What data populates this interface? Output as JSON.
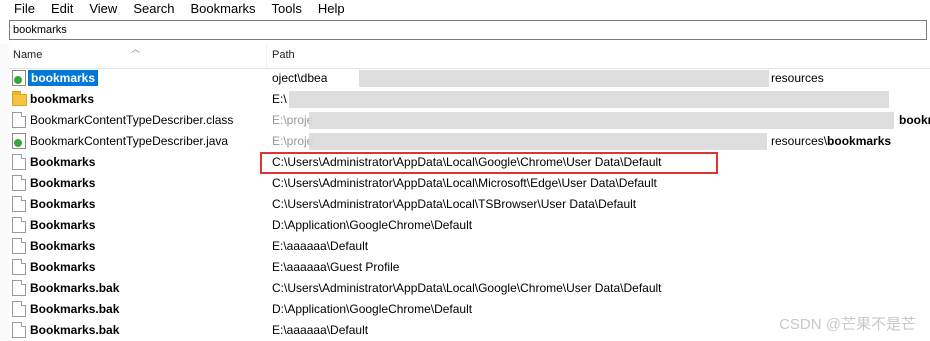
{
  "menu": [
    "File",
    "Edit",
    "View",
    "Search",
    "Bookmarks",
    "Tools",
    "Help"
  ],
  "search": {
    "value": "bookmarks"
  },
  "columns": {
    "name": "Name",
    "path": "Path"
  },
  "rows": [
    {
      "name": "bookmarks",
      "path": "",
      "icon": "app-file-icon",
      "bold": true,
      "selected": true
    },
    {
      "name": "bookmarks",
      "path": "E:\\",
      "icon": "folder-icon",
      "bold": true,
      "selected": false
    },
    {
      "name": "BookmarkContentTypeDescriber.class",
      "path": "",
      "icon": "file-icon",
      "bold": false,
      "selected": false
    },
    {
      "name": "BookmarkContentTypeDescriber.java",
      "path": "",
      "icon": "app-file-icon",
      "bold": false,
      "selected": false
    },
    {
      "name": "Bookmarks",
      "path": "C:\\Users\\Administrator\\AppData\\Local\\Google\\Chrome\\User Data\\Default",
      "icon": "file-icon",
      "bold": true,
      "selected": false
    },
    {
      "name": "Bookmarks",
      "path": "C:\\Users\\Administrator\\AppData\\Local\\Microsoft\\Edge\\User Data\\Default",
      "icon": "file-icon",
      "bold": true,
      "selected": false
    },
    {
      "name": "Bookmarks",
      "path": "C:\\Users\\Administrator\\AppData\\Local\\TSBrowser\\User Data\\Default",
      "icon": "file-icon",
      "bold": true,
      "selected": false
    },
    {
      "name": "Bookmarks",
      "path": "D:\\Application\\GoogleChrome\\Default",
      "icon": "file-icon",
      "bold": true,
      "selected": false
    },
    {
      "name": "Bookmarks",
      "path": "E:\\aaaaaa\\Default",
      "icon": "file-icon",
      "bold": true,
      "selected": false
    },
    {
      "name": "Bookmarks",
      "path": "E:\\aaaaaa\\Guest Profile",
      "icon": "file-icon",
      "bold": true,
      "selected": false
    },
    {
      "name": "Bookmarks.bak",
      "path": "C:\\Users\\Administrator\\AppData\\Local\\Google\\Chrome\\User Data\\Default",
      "icon": "file-icon",
      "bold": true,
      "selected": false
    },
    {
      "name": "Bookmarks.bak",
      "path": "D:\\Application\\GoogleChrome\\Default",
      "icon": "file-icon",
      "bold": true,
      "selected": false
    },
    {
      "name": "Bookmarks.bak",
      "path": "E:\\aaaaaa\\Default",
      "icon": "file-icon",
      "bold": true,
      "selected": false
    }
  ],
  "partial_paths": {
    "row0_left": "oject\\dbea",
    "row0_right": "resources",
    "row2_left": "E:\\proje",
    "row2_right": "bookm",
    "row3_left": "E:\\proje",
    "row3_right_plain": "resources\\",
    "row3_right_bold": "bookmarks"
  },
  "watermark": "CSDN @芒果不是芒",
  "colors": {
    "selection": "#0078d7",
    "highlight_border": "#e03434"
  }
}
